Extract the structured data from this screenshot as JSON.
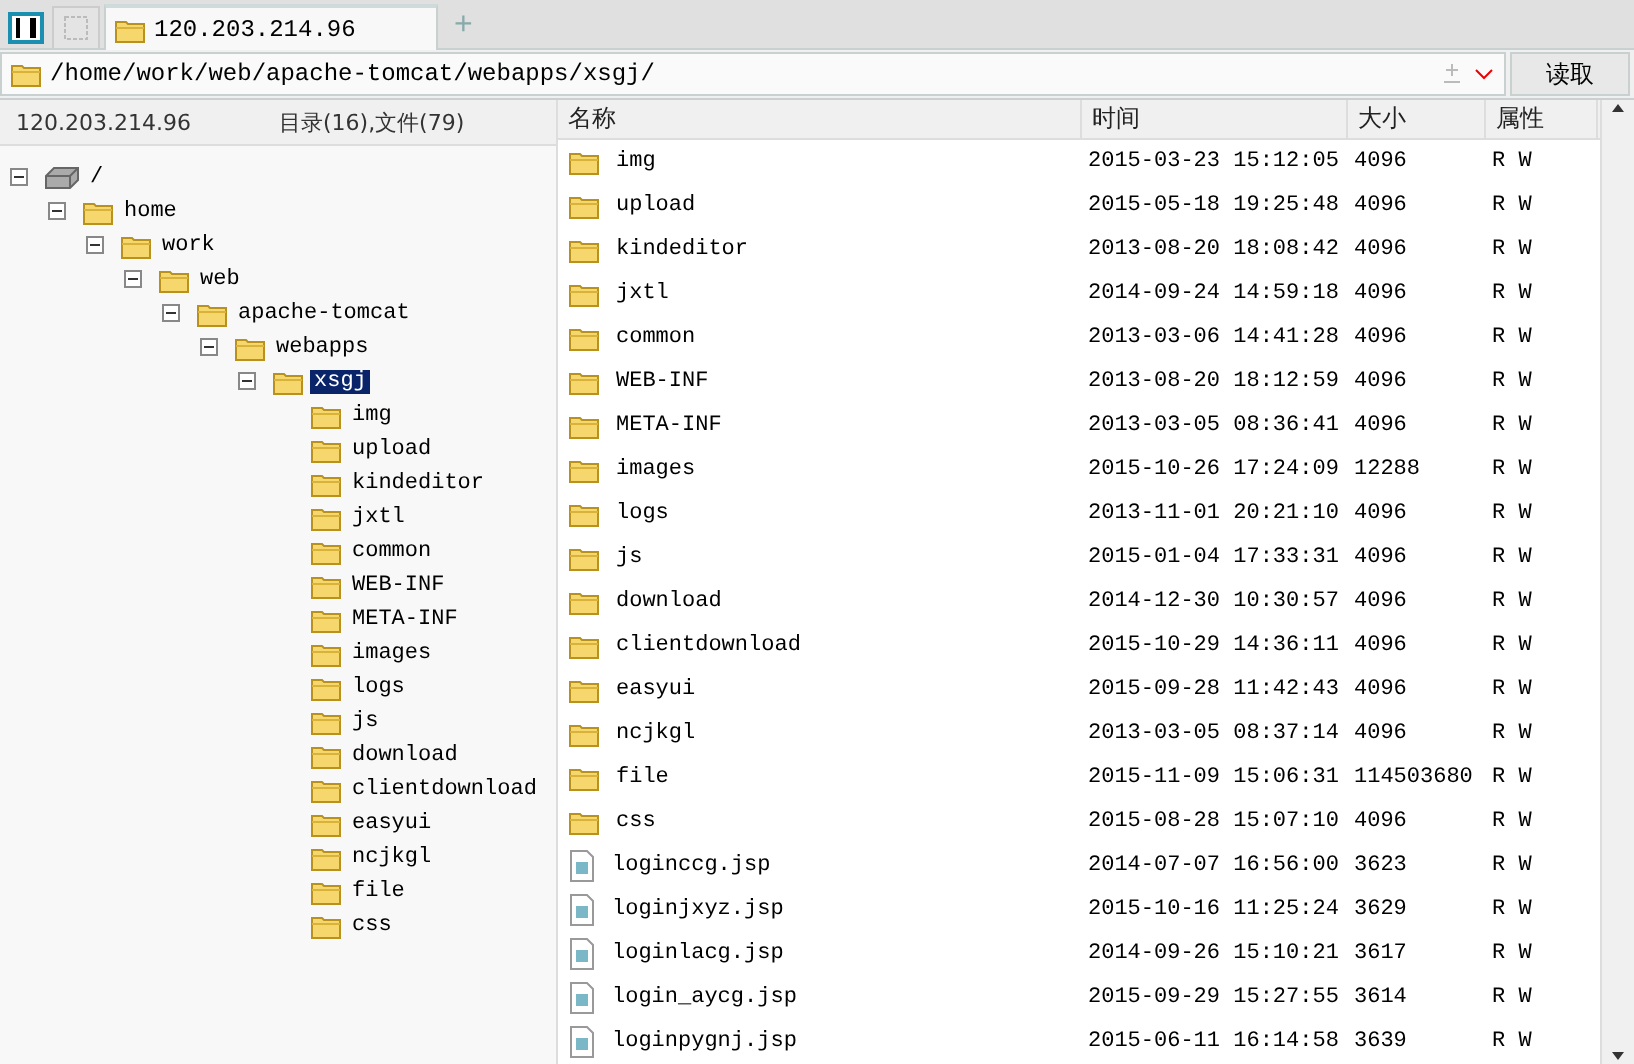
{
  "tabs": [
    {
      "label": "120.203.214.96",
      "selected": true
    }
  ],
  "new_tab": "+",
  "address": {
    "value": "/home/work/web/apache-tomcat/webapps/xsgj/"
  },
  "read_button": "读取",
  "tree_header": {
    "host": "120.203.214.96",
    "summary": "目录(16),文件(79)"
  },
  "tree": [
    {
      "label": "/",
      "kind": "drive",
      "expanded": true,
      "selected": false,
      "children": [
        {
          "label": "home",
          "kind": "folder",
          "expanded": true,
          "selected": false,
          "children": [
            {
              "label": "work",
              "kind": "folder",
              "expanded": true,
              "selected": false,
              "children": [
                {
                  "label": "web",
                  "kind": "folder",
                  "expanded": true,
                  "selected": false,
                  "children": [
                    {
                      "label": "apache-tomcat",
                      "kind": "folder",
                      "expanded": true,
                      "selected": false,
                      "children": [
                        {
                          "label": "webapps",
                          "kind": "folder",
                          "expanded": true,
                          "selected": false,
                          "children": [
                            {
                              "label": "xsgj",
                              "kind": "folder",
                              "expanded": true,
                              "selected": true,
                              "children": [
                                {
                                  "label": "img",
                                  "kind": "folder",
                                  "selected": false
                                },
                                {
                                  "label": "upload",
                                  "kind": "folder",
                                  "selected": false
                                },
                                {
                                  "label": "kindeditor",
                                  "kind": "folder",
                                  "selected": false
                                },
                                {
                                  "label": "jxtl",
                                  "kind": "folder",
                                  "selected": false
                                },
                                {
                                  "label": "common",
                                  "kind": "folder",
                                  "selected": false
                                },
                                {
                                  "label": "WEB-INF",
                                  "kind": "folder",
                                  "selected": false
                                },
                                {
                                  "label": "META-INF",
                                  "kind": "folder",
                                  "selected": false
                                },
                                {
                                  "label": "images",
                                  "kind": "folder",
                                  "selected": false
                                },
                                {
                                  "label": "logs",
                                  "kind": "folder",
                                  "selected": false
                                },
                                {
                                  "label": "js",
                                  "kind": "folder",
                                  "selected": false
                                },
                                {
                                  "label": "download",
                                  "kind": "folder",
                                  "selected": false
                                },
                                {
                                  "label": "clientdownload",
                                  "kind": "folder",
                                  "selected": false
                                },
                                {
                                  "label": "easyui",
                                  "kind": "folder",
                                  "selected": false
                                },
                                {
                                  "label": "ncjkgl",
                                  "kind": "folder",
                                  "selected": false
                                },
                                {
                                  "label": "file",
                                  "kind": "folder",
                                  "selected": false
                                },
                                {
                                  "label": "css",
                                  "kind": "folder",
                                  "selected": false
                                }
                              ]
                            }
                          ]
                        }
                      ]
                    }
                  ]
                }
              ]
            }
          ]
        }
      ]
    }
  ],
  "columns": [
    "名称",
    "时间",
    "大小",
    "属性"
  ],
  "rows": [
    {
      "kind": "folder",
      "name": "img",
      "time": "2015-03-23 15:12:05",
      "size": "4096",
      "attr": "R W"
    },
    {
      "kind": "folder",
      "name": "upload",
      "time": "2015-05-18 19:25:48",
      "size": "4096",
      "attr": "R W"
    },
    {
      "kind": "folder",
      "name": "kindeditor",
      "time": "2013-08-20 18:08:42",
      "size": "4096",
      "attr": "R W"
    },
    {
      "kind": "folder",
      "name": "jxtl",
      "time": "2014-09-24 14:59:18",
      "size": "4096",
      "attr": "R W"
    },
    {
      "kind": "folder",
      "name": "common",
      "time": "2013-03-06 14:41:28",
      "size": "4096",
      "attr": "R W"
    },
    {
      "kind": "folder",
      "name": "WEB-INF",
      "time": "2013-08-20 18:12:59",
      "size": "4096",
      "attr": "R W"
    },
    {
      "kind": "folder",
      "name": "META-INF",
      "time": "2013-03-05 08:36:41",
      "size": "4096",
      "attr": "R W"
    },
    {
      "kind": "folder",
      "name": "images",
      "time": "2015-10-26 17:24:09",
      "size": "12288",
      "attr": "R W"
    },
    {
      "kind": "folder",
      "name": "logs",
      "time": "2013-11-01 20:21:10",
      "size": "4096",
      "attr": "R W"
    },
    {
      "kind": "folder",
      "name": "js",
      "time": "2015-01-04 17:33:31",
      "size": "4096",
      "attr": "R W"
    },
    {
      "kind": "folder",
      "name": "download",
      "time": "2014-12-30 10:30:57",
      "size": "4096",
      "attr": "R W"
    },
    {
      "kind": "folder",
      "name": "clientdownload",
      "time": "2015-10-29 14:36:11",
      "size": "4096",
      "attr": "R W"
    },
    {
      "kind": "folder",
      "name": "easyui",
      "time": "2015-09-28 11:42:43",
      "size": "4096",
      "attr": "R W"
    },
    {
      "kind": "folder",
      "name": "ncjkgl",
      "time": "2013-03-05 08:37:14",
      "size": "4096",
      "attr": "R W"
    },
    {
      "kind": "folder",
      "name": "file",
      "time": "2015-11-09 15:06:31",
      "size": "114503680",
      "attr": "R W"
    },
    {
      "kind": "folder",
      "name": "css",
      "time": "2015-08-28 15:07:10",
      "size": "4096",
      "attr": "R W"
    },
    {
      "kind": "file",
      "name": "loginccg.jsp",
      "time": "2014-07-07 16:56:00",
      "size": "3623",
      "attr": "R W"
    },
    {
      "kind": "file",
      "name": "loginjxyz.jsp",
      "time": "2015-10-16 11:25:24",
      "size": "3629",
      "attr": "R W"
    },
    {
      "kind": "file",
      "name": "loginlacg.jsp",
      "time": "2014-09-26 15:10:21",
      "size": "3617",
      "attr": "R W"
    },
    {
      "kind": "file",
      "name": "login_aycg.jsp",
      "time": "2015-09-29 15:27:55",
      "size": "3614",
      "attr": "R W"
    },
    {
      "kind": "file",
      "name": "loginpygnj.jsp",
      "time": "2015-06-11 16:14:58",
      "size": "3639",
      "attr": "R W"
    }
  ]
}
